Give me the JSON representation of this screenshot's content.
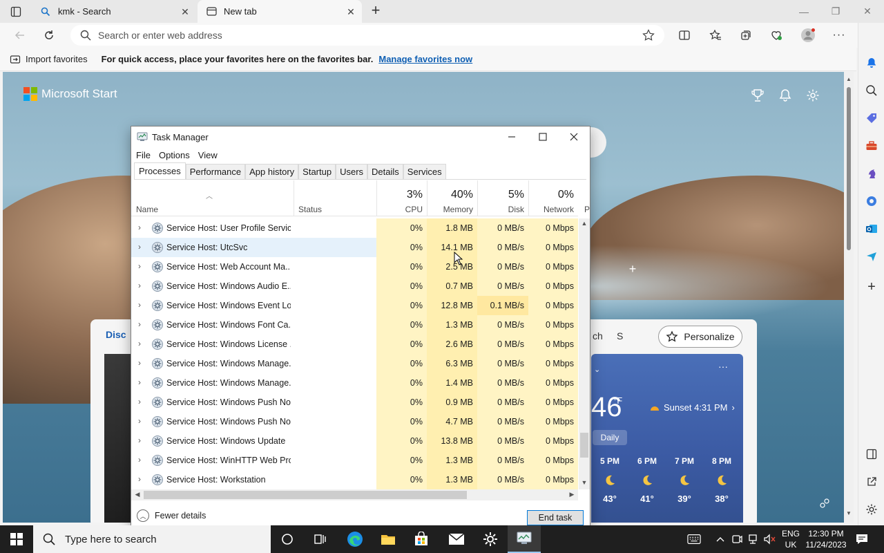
{
  "browser": {
    "tabs": [
      {
        "label": "kmk - Search"
      },
      {
        "label": "New tab"
      }
    ],
    "address_placeholder": "Search or enter web address",
    "favbar": {
      "import_label": "Import favorites",
      "hint": "For quick access, place your favorites here on the favorites bar.",
      "manage_link": "Manage favorites now"
    }
  },
  "page": {
    "brand": "Microsoft Start",
    "feed_tab_partial": "Disc",
    "feed_tab_ch": "ch",
    "feed_tab_s": "S",
    "personalize": "Personalize",
    "weather": {
      "temp": "46",
      "unit": "°F",
      "sunset": "Sunset 4:31 PM",
      "daily": "Daily",
      "hours": [
        {
          "time": "5 PM",
          "temp": "43°"
        },
        {
          "time": "6 PM",
          "temp": "41°"
        },
        {
          "time": "7 PM",
          "temp": "39°"
        },
        {
          "time": "8 PM",
          "temp": "38°"
        }
      ]
    }
  },
  "taskmanager": {
    "title": "Task Manager",
    "menu": [
      "File",
      "Options",
      "View"
    ],
    "tabs": [
      "Processes",
      "Performance",
      "App history",
      "Startup",
      "Users",
      "Details",
      "Services"
    ],
    "active_tab": "Processes",
    "columns": {
      "name": "Name",
      "status": "Status",
      "cpu": {
        "pct": "3%",
        "label": "CPU"
      },
      "memory": {
        "pct": "40%",
        "label": "Memory"
      },
      "disk": {
        "pct": "5%",
        "label": "Disk"
      },
      "network": {
        "pct": "0%",
        "label": "Network"
      },
      "partial": "P"
    },
    "rows": [
      {
        "name": "Service Host: User Profile Service",
        "cpu": "0%",
        "mem": "1.8 MB",
        "disk": "0 MB/s",
        "net": "0 Mbps"
      },
      {
        "name": "Service Host: UtcSvc",
        "cpu": "0%",
        "mem": "14.1 MB",
        "disk": "0 MB/s",
        "net": "0 Mbps"
      },
      {
        "name": "Service Host: Web Account Ma...",
        "cpu": "0%",
        "mem": "2.5 MB",
        "disk": "0 MB/s",
        "net": "0 Mbps"
      },
      {
        "name": "Service Host: Windows Audio E...",
        "cpu": "0%",
        "mem": "0.7 MB",
        "disk": "0 MB/s",
        "net": "0 Mbps"
      },
      {
        "name": "Service Host: Windows Event Log",
        "cpu": "0%",
        "mem": "12.8 MB",
        "disk": "0.1 MB/s",
        "net": "0 Mbps"
      },
      {
        "name": "Service Host: Windows Font Ca...",
        "cpu": "0%",
        "mem": "1.3 MB",
        "disk": "0 MB/s",
        "net": "0 Mbps"
      },
      {
        "name": "Service Host: Windows License ...",
        "cpu": "0%",
        "mem": "2.6 MB",
        "disk": "0 MB/s",
        "net": "0 Mbps"
      },
      {
        "name": "Service Host: Windows Manage...",
        "cpu": "0%",
        "mem": "6.3 MB",
        "disk": "0 MB/s",
        "net": "0 Mbps"
      },
      {
        "name": "Service Host: Windows Manage...",
        "cpu": "0%",
        "mem": "1.4 MB",
        "disk": "0 MB/s",
        "net": "0 Mbps"
      },
      {
        "name": "Service Host: Windows Push No...",
        "cpu": "0%",
        "mem": "0.9 MB",
        "disk": "0 MB/s",
        "net": "0 Mbps"
      },
      {
        "name": "Service Host: Windows Push No...",
        "cpu": "0%",
        "mem": "4.7 MB",
        "disk": "0 MB/s",
        "net": "0 Mbps"
      },
      {
        "name": "Service Host: Windows Update",
        "cpu": "0%",
        "mem": "13.8 MB",
        "disk": "0 MB/s",
        "net": "0 Mbps"
      },
      {
        "name": "Service Host: WinHTTP Web Pro...",
        "cpu": "0%",
        "mem": "1.3 MB",
        "disk": "0 MB/s",
        "net": "0 Mbps"
      },
      {
        "name": "Service Host: Workstation",
        "cpu": "0%",
        "mem": "1.3 MB",
        "disk": "0 MB/s",
        "net": "0 Mbps"
      }
    ],
    "highlighted_row": 1,
    "fewer_details": "Fewer details",
    "end_task": "End task"
  },
  "taskbar": {
    "search_placeholder": "Type here to search",
    "lang_top": "ENG",
    "lang_bottom": "UK",
    "time": "12:30 PM",
    "date": "11/24/2023"
  },
  "colors": {
    "cpu_col": "#fff4c4",
    "mem_col": "#ffefb0",
    "disk_hot": "#ffe8a0",
    "accent": "#0078d7"
  }
}
